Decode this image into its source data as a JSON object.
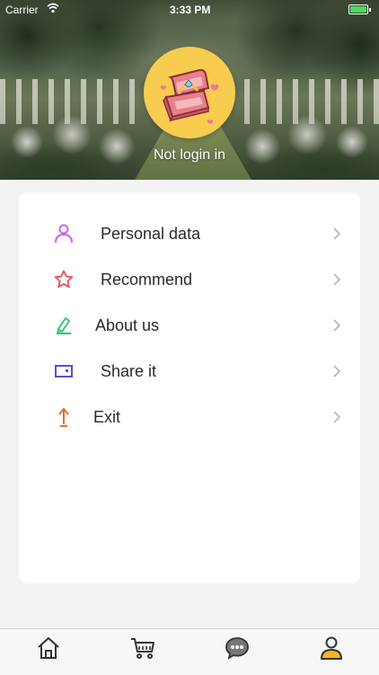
{
  "status_bar": {
    "carrier": "Carrier",
    "time": "3:33 PM",
    "wifi_icon": "wifi-icon",
    "battery_icon": "battery-icon",
    "battery_level": 1.0,
    "battery_color": "#4cd964"
  },
  "header": {
    "avatar_icon": "ring-box-icon",
    "avatar_bg": "#f8cc4f",
    "login_text": "Not login in"
  },
  "menu": {
    "items": [
      {
        "label": "Personal data",
        "icon": "person-icon",
        "icon_color": "#d061e6"
      },
      {
        "label": "Recommend",
        "icon": "star-icon",
        "icon_color": "#e5586e"
      },
      {
        "label": "About us",
        "icon": "pen-icon",
        "icon_color": "#3cc47c"
      },
      {
        "label": "Share it",
        "icon": "share-box-icon",
        "icon_color": "#5a4fd2"
      },
      {
        "label": "Exit",
        "icon": "exit-arrow-icon",
        "icon_color": "#e96a2a"
      }
    ],
    "chevron_icon": "chevron-right-icon"
  },
  "tabbar": {
    "tabs": [
      {
        "name": "home",
        "icon": "home-icon"
      },
      {
        "name": "cart",
        "icon": "cart-icon"
      },
      {
        "name": "messages",
        "icon": "chat-icon"
      },
      {
        "name": "profile",
        "icon": "profile-icon",
        "active": true
      }
    ],
    "active_color": "#f2b51c"
  }
}
